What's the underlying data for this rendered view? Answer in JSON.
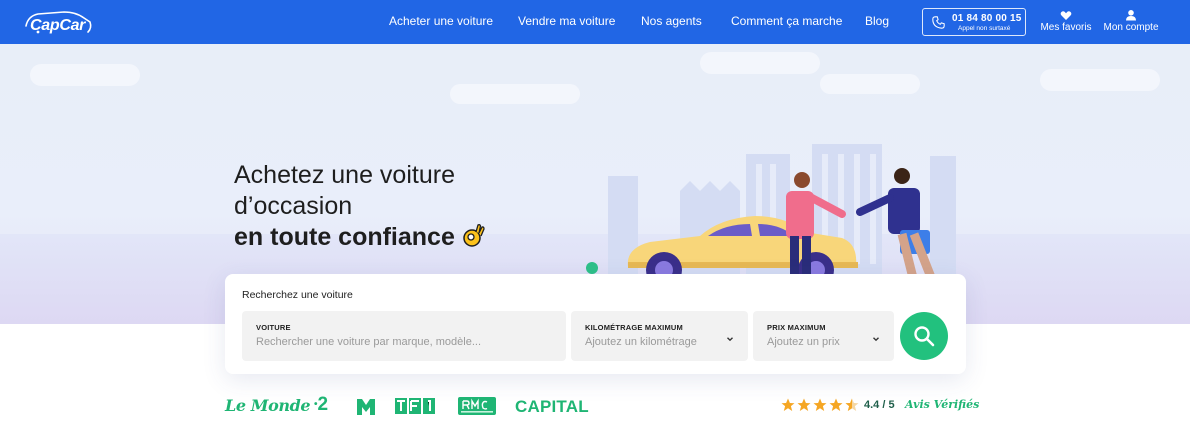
{
  "brand": {
    "name": "CapCar"
  },
  "nav": {
    "links": [
      "Acheter une voiture",
      "Vendre ma voiture",
      "Nos agents",
      "Comment ça marche",
      "Blog"
    ],
    "phone": {
      "number": "01 84 80 00 15",
      "note": "Appel non surtaxé"
    },
    "favorites": "Mes favoris",
    "account": "Mon compte"
  },
  "hero": {
    "line1": "Achetez une voiture",
    "line2": "d’occasion",
    "line3": "en toute confiance"
  },
  "search": {
    "title": "Recherchez une voiture",
    "fields": [
      {
        "label": "VOITURE",
        "placeholder": "Rechercher une voiture par marque, modèle..."
      },
      {
        "label": "KILOMÉTRAGE MAXIMUM",
        "placeholder": "Ajoutez un kilométrage"
      },
      {
        "label": "PRIX MAXIMUM",
        "placeholder": "Ajoutez un prix"
      }
    ]
  },
  "press": {
    "lemonde": "Le Monde",
    "france2": "2",
    "m6": "M",
    "tf1": "TF1",
    "rmc": "RMC",
    "capital": "CAPITAL"
  },
  "rating": {
    "score": "4.4 / 5",
    "stars": 4.4,
    "label": "Avis Vérifiés"
  },
  "colors": {
    "nav": "#2166e5",
    "accent_green": "#22c17e",
    "star": "#f5a623"
  }
}
